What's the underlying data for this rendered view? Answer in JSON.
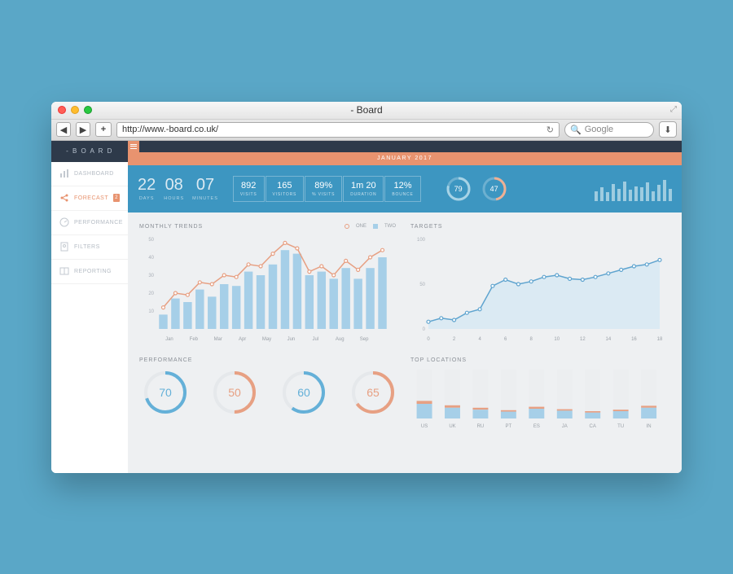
{
  "window": {
    "title": "- Board",
    "url": "http://www.-board.co.uk/",
    "search_placeholder": "Google"
  },
  "brand": "- B O A R D",
  "sidebar": {
    "items": [
      {
        "label": "DASHBOARD"
      },
      {
        "label": "FORECAST",
        "badge": "2"
      },
      {
        "label": "PERFORMANCE"
      },
      {
        "label": "FILTERS"
      },
      {
        "label": "REPORTING"
      }
    ]
  },
  "month_label": "JANUARY 2017",
  "countdown": {
    "days": "22",
    "days_label": "DAYS",
    "hours": "08",
    "hours_label": "HOURS",
    "minutes": "07",
    "minutes_label": "MINUTES"
  },
  "metrics": [
    {
      "value": "892",
      "label": "VISITS"
    },
    {
      "value": "165",
      "label": "VISITORS"
    },
    {
      "value": "89%",
      "label": "% VISITS"
    },
    {
      "value": "1m 20",
      "label": "DURATION"
    },
    {
      "value": "12%",
      "label": "BOUNCE"
    }
  ],
  "gauges": [
    {
      "value": "79",
      "pct": 79
    },
    {
      "value": "47",
      "pct": 47
    }
  ],
  "sparkline": [
    40,
    55,
    35,
    70,
    50,
    80,
    45,
    60,
    55,
    75,
    40,
    65,
    85,
    50
  ],
  "panel_titles": {
    "trends": "MONTHLY TRENDS",
    "targets": "TARGETS",
    "performance": "PERFORMANCE",
    "locations": "TOP LOCATIONS"
  },
  "legend": {
    "one": "ONE",
    "two": "TWO"
  },
  "performance": [
    {
      "value": "70",
      "pct": 70,
      "color": "#64b0d8"
    },
    {
      "value": "50",
      "pct": 50,
      "color": "#e7a083"
    },
    {
      "value": "60",
      "pct": 60,
      "color": "#64b0d8"
    },
    {
      "value": "65",
      "pct": 65,
      "color": "#e7a083"
    }
  ],
  "chart_data": [
    {
      "type": "bar-line",
      "title": "MONTHLY TRENDS",
      "categories": [
        "Jan",
        "Feb",
        "Mar",
        "Apr",
        "May",
        "Jun",
        "Jul",
        "Aug",
        "Sep"
      ],
      "ylim": [
        0,
        50
      ],
      "yticks": [
        10,
        20,
        30,
        40,
        50
      ],
      "series": [
        {
          "name": "TWO",
          "kind": "bar",
          "color": "#a6cfe8",
          "values": [
            8,
            17,
            15,
            22,
            18,
            25,
            24,
            32,
            30,
            36,
            44,
            42,
            30,
            32,
            28,
            34,
            28,
            34,
            40
          ]
        },
        {
          "name": "ONE",
          "kind": "line",
          "color": "#e7a083",
          "values": [
            12,
            20,
            19,
            26,
            25,
            30,
            29,
            36,
            35,
            42,
            48,
            45,
            32,
            35,
            30,
            38,
            33,
            40,
            44
          ]
        }
      ]
    },
    {
      "type": "area-line",
      "title": "TARGETS",
      "x": [
        0,
        2,
        4,
        6,
        8,
        10,
        12,
        14,
        16,
        18
      ],
      "ylim": [
        0,
        100
      ],
      "yticks": [
        0,
        50,
        100
      ],
      "series": [
        {
          "name": "area",
          "color": "#cfe4f0",
          "values": [
            8,
            12,
            10,
            18,
            22,
            48,
            55,
            50,
            53,
            58,
            60,
            56,
            55,
            58,
            62,
            66,
            70,
            72,
            77
          ]
        },
        {
          "name": "line",
          "color": "#5fa4cf",
          "values": [
            8,
            12,
            10,
            18,
            22,
            48,
            55,
            50,
            53,
            58,
            60,
            56,
            55,
            58,
            62,
            66,
            70,
            72,
            77
          ]
        }
      ]
    },
    {
      "type": "stacked-bar",
      "title": "TOP LOCATIONS",
      "categories": [
        "US",
        "UK",
        "RU",
        "PT",
        "ES",
        "JA",
        "CA",
        "TU",
        "IN"
      ],
      "series": [
        {
          "name": "a",
          "color": "#a6cfe8",
          "values": [
            30,
            22,
            18,
            14,
            20,
            16,
            12,
            15,
            22
          ]
        },
        {
          "name": "b",
          "color": "#e7a083",
          "values": [
            6,
            5,
            4,
            3,
            4,
            3,
            3,
            3,
            4
          ]
        },
        {
          "name": "c",
          "color": "#eceef0",
          "values": [
            64,
            73,
            78,
            83,
            76,
            81,
            85,
            82,
            74
          ]
        }
      ]
    }
  ]
}
